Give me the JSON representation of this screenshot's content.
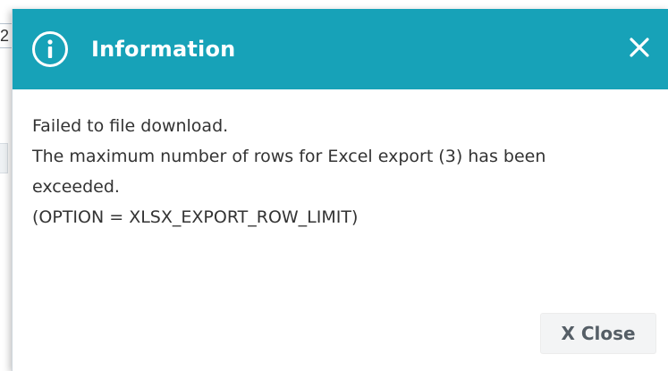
{
  "background": {
    "fragment_text": "2"
  },
  "dialog": {
    "title": "Information",
    "header_color": "#17a2b8",
    "header_icon": "info-circle-icon",
    "close_icon": "close-icon",
    "message_lines": [
      "Failed to file download.",
      "The maximum number of rows for Excel export (3) has been",
      "exceeded.",
      "(OPTION = XLSX_EXPORT_ROW_LIMIT)"
    ],
    "close_button_label": "X Close"
  }
}
